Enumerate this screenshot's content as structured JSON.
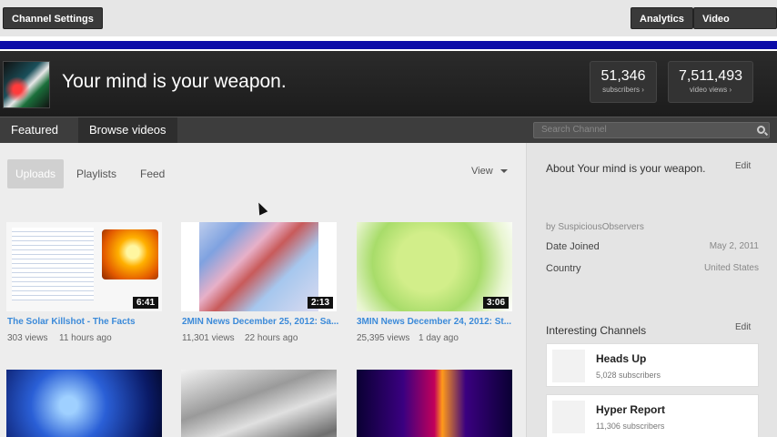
{
  "topbar": {
    "channel_settings": "Channel Settings",
    "analytics": "Analytics",
    "video_manager": "Video Manager"
  },
  "header": {
    "title": "Your mind is your weapon.",
    "subscribers_count": "51,346",
    "subscribers_label": "subscribers ›",
    "views_count": "7,511,493",
    "views_label": "video views ›"
  },
  "tabs": {
    "featured": "Featured",
    "browse": "Browse videos",
    "search_placeholder": "Search Channel"
  },
  "main": {
    "subtabs": [
      "Uploads",
      "Playlists",
      "Feed"
    ],
    "view_label": "View",
    "videos": [
      {
        "title": "The Solar Killshot - The Facts",
        "views": "303 views",
        "age": "11 hours ago",
        "duration": "6:41"
      },
      {
        "title": "2MIN News December 25, 2012: Sa...",
        "views": "11,301 views",
        "age": "22 hours ago",
        "duration": "2:13"
      },
      {
        "title": "3MIN News December 24, 2012: St...",
        "views": "25,395 views",
        "age": "1 day ago",
        "duration": "3:06"
      }
    ]
  },
  "sidebar": {
    "about_title": "About Your mind is your weapon.",
    "edit_label": "Edit",
    "by_line": "by SuspiciousObservers",
    "date_joined_label": "Date Joined",
    "date_joined_value": "May 2, 2011",
    "country_label": "Country",
    "country_value": "United States",
    "interesting_title": "Interesting Channels",
    "channels": [
      {
        "name": "Heads Up",
        "subs": "5,028 subscribers"
      },
      {
        "name": "Hyper Report",
        "subs": "11,306 subscribers"
      }
    ]
  }
}
